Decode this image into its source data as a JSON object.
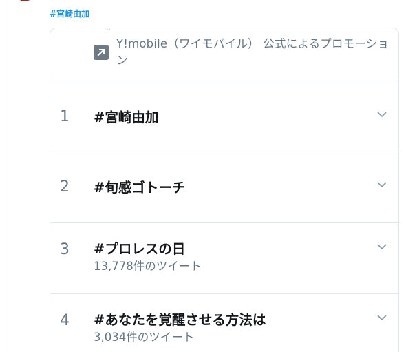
{
  "tweet": {
    "hashtag": "#宮崎由加"
  },
  "promotion": {
    "text": "Y!mobile（ワイモバイル） 公式によるプロモーション"
  },
  "trends": [
    {
      "rank": "1",
      "name": "#宮崎由加",
      "count": ""
    },
    {
      "rank": "2",
      "name": "#旬感ゴトーチ",
      "count": ""
    },
    {
      "rank": "3",
      "name": "#プロレスの日",
      "count": "13,778件のツイート"
    },
    {
      "rank": "4",
      "name": "#あなたを覚醒させる方法は",
      "count": "3,034件のツイート"
    }
  ],
  "icons": {
    "promoted": "promoted-arrow-icon",
    "chevron": "chevron-down-icon"
  },
  "colors": {
    "link": "#1b95e0",
    "secondary_text": "#657786",
    "primary_text": "#14171a",
    "border": "#e1e8ed"
  }
}
